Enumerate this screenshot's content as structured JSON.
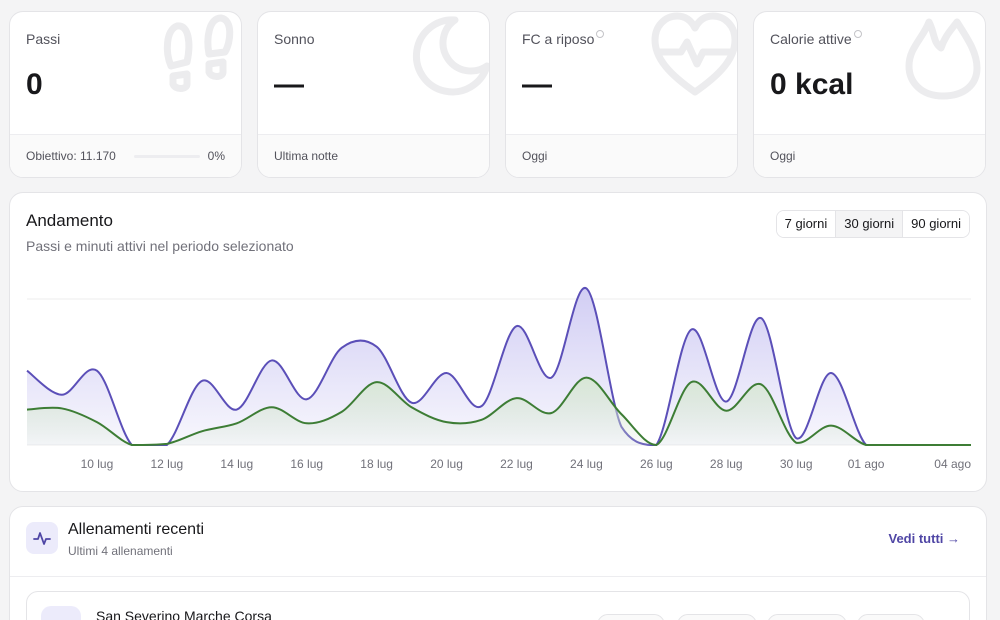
{
  "stats": [
    {
      "label": "Passi",
      "value": "0",
      "footer": "Obiettivo: 11.170",
      "pct": "0%",
      "goal_fraction": 0,
      "icon": "footprints-icon"
    },
    {
      "label": "Sonno",
      "value": "—",
      "footer": "Ultima notte",
      "icon": "moon-icon"
    },
    {
      "label": "FC a riposo",
      "value": "—",
      "footer": "Oggi",
      "icon": "heart-pulse-icon",
      "info_icon": true
    },
    {
      "label": "Calorie attive",
      "value": "0 kcal",
      "footer": "Oggi",
      "icon": "flame-icon",
      "info_icon": true
    }
  ],
  "trend": {
    "title": "Andamento",
    "subtitle": "Passi e minuti attivi nel periodo selezionato",
    "ranges": [
      "7 giorni",
      "30 giorni",
      "90 giorni"
    ],
    "selected_range": "30 giorni"
  },
  "chart_data": {
    "type": "area",
    "x_tick_labels": [
      "10 lug",
      "12 lug",
      "14 lug",
      "16 lug",
      "18 lug",
      "20 lug",
      "22 lug",
      "24 lug",
      "26 lug",
      "28 lug",
      "30 lug",
      "01 ago",
      "04 ago"
    ],
    "x": [
      "08 lug",
      "09 lug",
      "10 lug",
      "11 lug",
      "12 lug",
      "13 lug",
      "14 lug",
      "15 lug",
      "16 lug",
      "17 lug",
      "18 lug",
      "19 lug",
      "20 lug",
      "21 lug",
      "22 lug",
      "23 lug",
      "24 lug",
      "25 lug",
      "26 lug",
      "27 lug",
      "28 lug",
      "29 lug",
      "30 lug",
      "31 lug",
      "01 ago",
      "02 ago",
      "03 ago",
      "04 ago"
    ],
    "series": [
      {
        "color": "#5b4fb8",
        "fill": "#cfcbf3",
        "values": [
          65,
          44,
          65,
          0,
          0,
          56,
          31,
          74,
          40,
          85,
          86,
          37,
          63,
          34,
          104,
          59,
          137,
          16,
          0,
          101,
          38,
          111,
          6,
          63,
          0,
          0,
          0,
          0
        ]
      },
      {
        "color": "#3d7d35",
        "fill": "#d7e7d3",
        "values": [
          31,
          32,
          20,
          0,
          1,
          12,
          19,
          33,
          19,
          29,
          55,
          33,
          20,
          22,
          41,
          28,
          59,
          27,
          0,
          55,
          30,
          53,
          2,
          17,
          0,
          0,
          0,
          0
        ]
      }
    ],
    "grid": true,
    "legend": "none"
  },
  "workouts": {
    "title": "Allenamenti recenti",
    "subtitle": "Ultimi 4 allenamenti",
    "see_all": "Vedi tutti →",
    "items": [
      {
        "title": "San Severino Marche Corsa",
        "icon": "running-icon"
      }
    ]
  }
}
